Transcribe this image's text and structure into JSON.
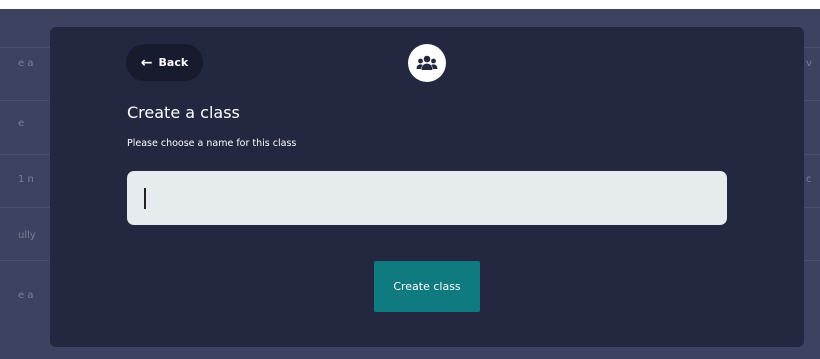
{
  "background": {
    "left_fragments": [
      "e a",
      "e",
      "1 n",
      "ully",
      "e a"
    ],
    "right_fragments": [
      "v",
      "",
      "c",
      "",
      ""
    ]
  },
  "modal": {
    "back_label": "Back",
    "back_icon": "arrow-left-icon",
    "header_icon": "users-group-icon",
    "title": "Create a class",
    "subtitle": "Please choose a name for this class",
    "name_input": {
      "value": "",
      "placeholder": ""
    },
    "create_label": "Create class"
  },
  "colors": {
    "modal_bg": "#232840",
    "input_bg": "#e6ebee",
    "accent": "#0f7a80",
    "back_button_bg": "#181b2e"
  }
}
